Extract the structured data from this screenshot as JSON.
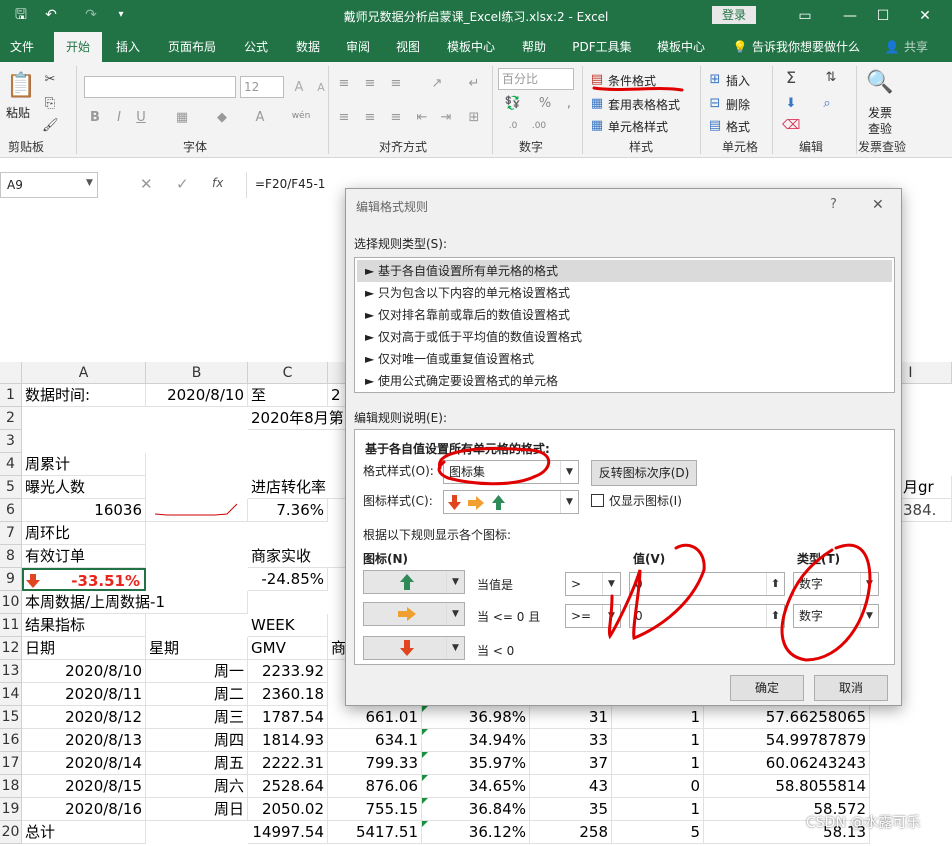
{
  "app": {
    "title": "戴师兄数据分析启蒙课_Excel练习.xlsx:2  -  Excel",
    "login": "登录"
  },
  "tabs": [
    "文件",
    "开始",
    "插入",
    "页面布局",
    "公式",
    "数据",
    "审阅",
    "视图",
    "模板中心",
    "帮助",
    "PDF工具集",
    "模板中心",
    "告诉我你想要做什么",
    "共享"
  ],
  "ribbon": {
    "paste": "粘贴",
    "clipboard": "剪贴板",
    "font_size": "12",
    "font": "字体",
    "align": "对齐方式",
    "number_format": "百分比",
    "number": "数字",
    "cond_format": "条件格式",
    "table_format": "套用表格格式",
    "cell_style": "单元格样式",
    "style": "样式",
    "insert": "插入",
    "delete": "删除",
    "format": "格式",
    "cells": "单元格",
    "edit": "编辑",
    "find1": "发票",
    "find2": "查验",
    "invoice": "发票查验",
    "percent": "%",
    "wen": "wén",
    "fill_a": "A"
  },
  "formula_bar": {
    "name_box": "A9",
    "formula": "=F20/F45-1",
    "fx": "fx"
  },
  "columns": [
    "A",
    "B",
    "C",
    "I"
  ],
  "rows": [
    "1",
    "2",
    "3",
    "4",
    "5",
    "6",
    "7",
    "8",
    "9",
    "10",
    "11",
    "12",
    "13",
    "14",
    "15",
    "16",
    "17",
    "18",
    "19",
    "20"
  ],
  "sheet": {
    "r1": {
      "a": "数据时间:",
      "b": "2020/8/10",
      "c": "至",
      "d": "2"
    },
    "r2": {
      "c": "2020年8月第1"
    },
    "r4": {
      "a": "周累计"
    },
    "r5": {
      "a": "曝光人数",
      "c": "进店转化率",
      "i": "月gr"
    },
    "r6": {
      "a": "16036",
      "c": "7.36%",
      "i": "384."
    },
    "r7": {
      "a": "周环比"
    },
    "r8": {
      "a": "有效订单",
      "c": "商家实收"
    },
    "r9": {
      "a": "-33.51%",
      "c": "-24.85%"
    },
    "r10": {
      "a": "本周数据/上周数据-1"
    },
    "r11": {
      "a": "结果指标",
      "c": "WEEK"
    },
    "r12": {
      "a": "日期",
      "b": "星期",
      "c": "GMV",
      "d": "商"
    },
    "data_rows": [
      {
        "date": "2020/8/10",
        "week": "周一",
        "gmv": "2233.92",
        "d": "",
        "e": "",
        "f": "",
        "g": "",
        "h": ""
      },
      {
        "date": "2020/8/11",
        "week": "周二",
        "gmv": "2360.18",
        "d": "",
        "e": "",
        "f": "",
        "g": "",
        "h": ""
      },
      {
        "date": "2020/8/12",
        "week": "周三",
        "gmv": "1787.54",
        "d": "661.01",
        "e": "36.98%",
        "f": "31",
        "g": "1",
        "h": "57.66258065"
      },
      {
        "date": "2020/8/13",
        "week": "周四",
        "gmv": "1814.93",
        "d": "634.1",
        "e": "34.94%",
        "f": "33",
        "g": "1",
        "h": "54.99787879"
      },
      {
        "date": "2020/8/14",
        "week": "周五",
        "gmv": "2222.31",
        "d": "799.33",
        "e": "35.97%",
        "f": "37",
        "g": "1",
        "h": "60.06243243"
      },
      {
        "date": "2020/8/15",
        "week": "周六",
        "gmv": "2528.64",
        "d": "876.06",
        "e": "34.65%",
        "f": "43",
        "g": "0",
        "h": "58.8055814"
      },
      {
        "date": "2020/8/16",
        "week": "周日",
        "gmv": "2050.02",
        "d": "755.15",
        "e": "36.84%",
        "f": "35",
        "g": "1",
        "h": "58.572"
      }
    ],
    "total": {
      "a": "总计",
      "c": "14997.54",
      "d": "5417.51",
      "e": "36.12%",
      "f": "258",
      "g": "5",
      "h": "58.13"
    }
  },
  "dialog": {
    "title": "编辑格式规则",
    "help": "?",
    "close": "✕",
    "select_type": "选择规则类型(S):",
    "rule_types": [
      "► 基于各自值设置所有单元格的格式",
      "► 只为包含以下内容的单元格设置格式",
      "► 仅对排名靠前或靠后的数值设置格式",
      "► 仅对高于或低于平均值的数值设置格式",
      "► 仅对唯一值或重复值设置格式",
      "► 使用公式确定要设置格式的单元格"
    ],
    "edit_desc": "编辑规则说明(E):",
    "panel_title": "基于各自值设置所有单元格的格式:",
    "format_style_label": "格式样式(O):",
    "format_style_value": "图标集",
    "reverse_btn": "反转图标次序(D)",
    "icon_style_label": "图标样式(C):",
    "show_icon_only": "仅显示图标(I)",
    "rule_intro": "根据以下规则显示各个图标:",
    "col_icon": "图标(N)",
    "col_value": "值(V)",
    "col_type": "类型(T)",
    "rules": [
      {
        "cond": "当值是",
        "op": ">",
        "value": "0",
        "type": "数字",
        "icon": "up"
      },
      {
        "cond": "当 <= 0 且",
        "op": ">=",
        "value": "0",
        "type": "数字",
        "icon": "right"
      },
      {
        "cond": "当 < 0",
        "op": "",
        "value": "",
        "type": "",
        "icon": "down"
      }
    ],
    "ok": "确定",
    "cancel": "取消"
  },
  "watermark": "CSDN @水露可乐",
  "colors": {
    "excel_green": "#217346",
    "up": "#2e8b57",
    "right": "#f0a030",
    "down": "#e0451f",
    "annot": "#e00000"
  }
}
